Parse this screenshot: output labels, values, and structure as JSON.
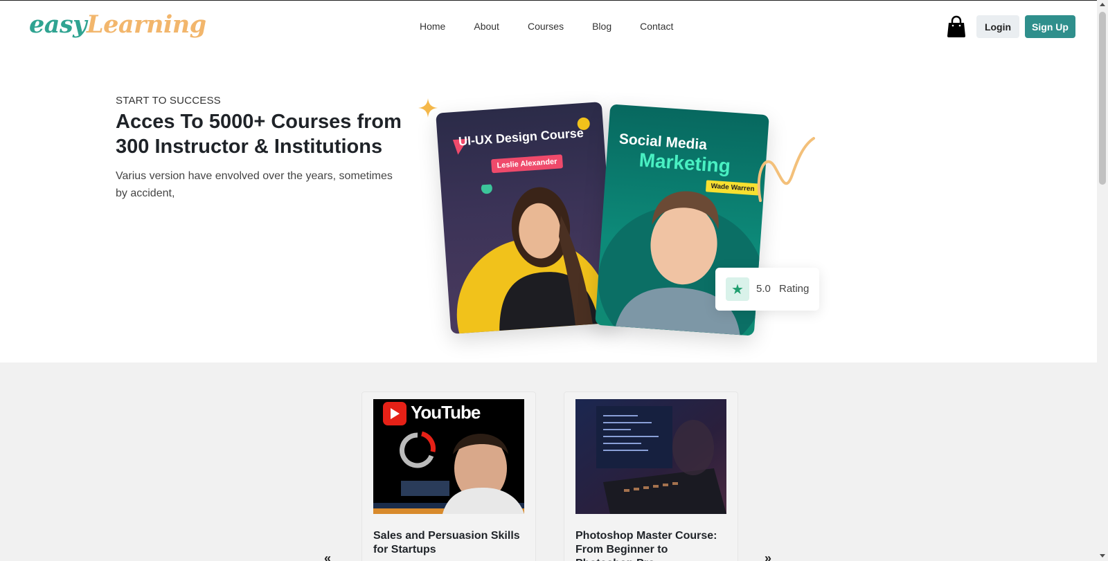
{
  "brand": {
    "part1": "easy",
    "part2": "Learning",
    "color_primary": "#2fa391",
    "color_secondary": "#f2b66c"
  },
  "nav": {
    "items": [
      {
        "label": "Home"
      },
      {
        "label": "About"
      },
      {
        "label": "Courses"
      },
      {
        "label": "Blog"
      },
      {
        "label": "Contact"
      }
    ]
  },
  "header": {
    "cart_icon": "shopping-bag-icon",
    "login_label": "Login",
    "signup_label": "Sign Up",
    "accent": "#2f8f8c"
  },
  "hero": {
    "eyebrow": "START TO SUCCESS",
    "title": "Acces To 5000+ Courses from 300 Instructor & Institutions",
    "subtitle": "Varius version have envolved over the years, sometimes by accident,",
    "cards": {
      "ux": {
        "title": "UI-UX Design Course",
        "instructor": "Leslie Alexander"
      },
      "sm": {
        "title_line1": "Social Media",
        "title_line2": "Marketing",
        "instructor": "Wade Warren"
      }
    },
    "rating": {
      "value": "5.0",
      "label": "Rating",
      "icon": "star-icon"
    }
  },
  "courses": [
    {
      "title": "Sales and Persuasion Skills for Startups",
      "thumb_text": "YouTube"
    },
    {
      "title": "Photoshop Master Course: From Beginner to Photoshop Pro"
    }
  ],
  "carousel": {
    "prev": "«",
    "next": "»"
  }
}
